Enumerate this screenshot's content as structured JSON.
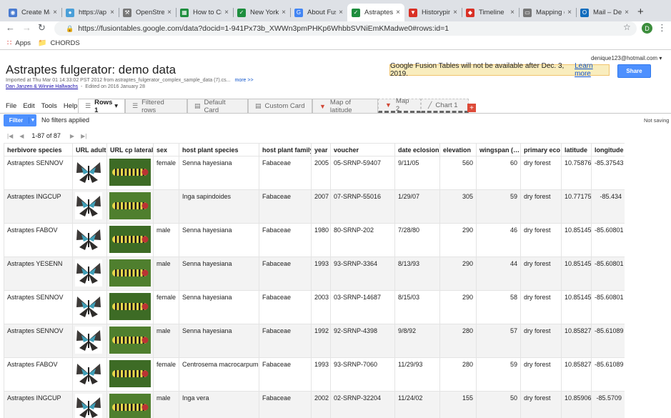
{
  "browser": {
    "tabs": [
      {
        "label": "Create Ma",
        "icon": "compass-icon",
        "color": "#4a7bd0"
      },
      {
        "label": "https://ap",
        "icon": "globe-icon",
        "color": "#4a9fd8"
      },
      {
        "label": "OpenStree",
        "icon": "tool-icon",
        "color": "#777777"
      },
      {
        "label": "How to Cr",
        "icon": "sheets-icon",
        "color": "#1e8e3e"
      },
      {
        "label": "New York",
        "icon": "check-icon",
        "color": "#1e8e3e"
      },
      {
        "label": "About Fus",
        "icon": "google-icon",
        "color": "#4285f4"
      },
      {
        "label": "Astraptes",
        "icon": "check-icon",
        "color": "#1e8e3e"
      },
      {
        "label": "Historypin",
        "icon": "pin-icon",
        "color": "#d93025"
      },
      {
        "label": "Timeline",
        "icon": "diamond-icon",
        "color": "#d93025"
      },
      {
        "label": "Mapping d",
        "icon": "doc-icon",
        "color": "#777777"
      },
      {
        "label": "Mail – Dei",
        "icon": "outlook-icon",
        "color": "#0f6cbd"
      }
    ],
    "active_tab": 6,
    "url": "https://fusiontables.google.com/data?docid=1-941Px73b_XWWn3pmPHKp6WhbbSVNiEmKMadwe0#rows:id=1",
    "avatar_letter": "D",
    "bookmarks": [
      {
        "label": "Apps",
        "icon": "apps-grid-icon"
      },
      {
        "label": "CHORDS",
        "icon": "folder-icon"
      }
    ]
  },
  "page": {
    "account": "denique123@hotmail.com",
    "title": "Astraptes fulgerator: demo data",
    "imported": "Imported at Thu Mar 01 14:33:02 PST 2012 from astraptes_fulgerator_complex_sample_data (7).cs...",
    "more_link": "more >>",
    "authors": "Dan Janzen & Winnie Hallwachs",
    "edited": "Edited on 2016 January 28",
    "notice": "Google Fusion Tables will not be available after Dec. 3, 2019.",
    "notice_link": "Learn more",
    "share_label": "Share",
    "menu": [
      "File",
      "Edit",
      "Tools",
      "Help"
    ],
    "view_tabs": [
      {
        "label": "Rows 1",
        "icon": "rows-icon",
        "active": true
      },
      {
        "label": "Filtered rows",
        "icon": "rows-icon"
      },
      {
        "label": "Default Card",
        "icon": "card-icon"
      },
      {
        "label": "Custom Card",
        "icon": "card-icon"
      },
      {
        "label": "Map of latitude",
        "icon": "map-pin-icon"
      },
      {
        "label": "Map 2",
        "icon": "map-pin-icon"
      },
      {
        "label": "Chart 1",
        "icon": "chart-icon"
      }
    ],
    "filter_label": "Filter",
    "no_filters": "No filters applied",
    "save_status": "Not saving",
    "pager": "1-87 of 87"
  },
  "table": {
    "columns": [
      "herbivore species",
      "URL adult",
      "URL cp lateral",
      "sex",
      "host plant species",
      "host plant family",
      "year",
      "voucher",
      "date eclosion",
      "elevation",
      "wingspan (…",
      "primary eco",
      "latitude",
      "longitude"
    ],
    "rows": [
      [
        "Astraptes SENNOV",
        "",
        "",
        "female",
        "Senna hayesiana",
        "Fabaceae",
        "2005",
        "05-SRNP-59407",
        "9/11/05",
        "560",
        "60",
        "dry forest",
        "10.75876",
        "-85.37543"
      ],
      [
        "Astraptes INGCUP",
        "",
        "",
        "",
        "Inga sapindoides",
        "Fabaceae",
        "2007",
        "07-SRNP-55016",
        "1/29/07",
        "305",
        "59",
        "dry forest",
        "10.77175",
        "-85.434"
      ],
      [
        "Astraptes FABOV",
        "",
        "",
        "male",
        "Senna hayesiana",
        "Fabaceae",
        "1980",
        "80-SRNP-202",
        "7/28/80",
        "290",
        "46",
        "dry forest",
        "10.85145",
        "-85.60801"
      ],
      [
        "Astraptes YESENN",
        "",
        "",
        "male",
        "Senna hayesiana",
        "Fabaceae",
        "1993",
        "93-SRNP-3364",
        "8/13/93",
        "290",
        "44",
        "dry forest",
        "10.85145",
        "-85.60801"
      ],
      [
        "Astraptes SENNOV",
        "",
        "",
        "female",
        "Senna hayesiana",
        "Fabaceae",
        "2003",
        "03-SRNP-14687",
        "8/15/03",
        "290",
        "58",
        "dry forest",
        "10.85145",
        "-85.60801"
      ],
      [
        "Astraptes SENNOV",
        "",
        "",
        "male",
        "Senna hayesiana",
        "Fabaceae",
        "1992",
        "92-SRNP-4398",
        "9/8/92",
        "280",
        "57",
        "dry forest",
        "10.85827",
        "-85.61089"
      ],
      [
        "Astraptes FABOV",
        "",
        "",
        "female",
        "Centrosema macrocarpum",
        "Fabaceae",
        "1993",
        "93-SRNP-7060",
        "11/29/93",
        "280",
        "59",
        "dry forest",
        "10.85827",
        "-85.61089"
      ],
      [
        "Astraptes INGCUP",
        "",
        "",
        "male",
        "Inga vera",
        "Fabaceae",
        "2002",
        "02-SRNP-32204",
        "11/24/02",
        "155",
        "50",
        "dry forest",
        "10.85906",
        "-85.5709"
      ]
    ]
  }
}
